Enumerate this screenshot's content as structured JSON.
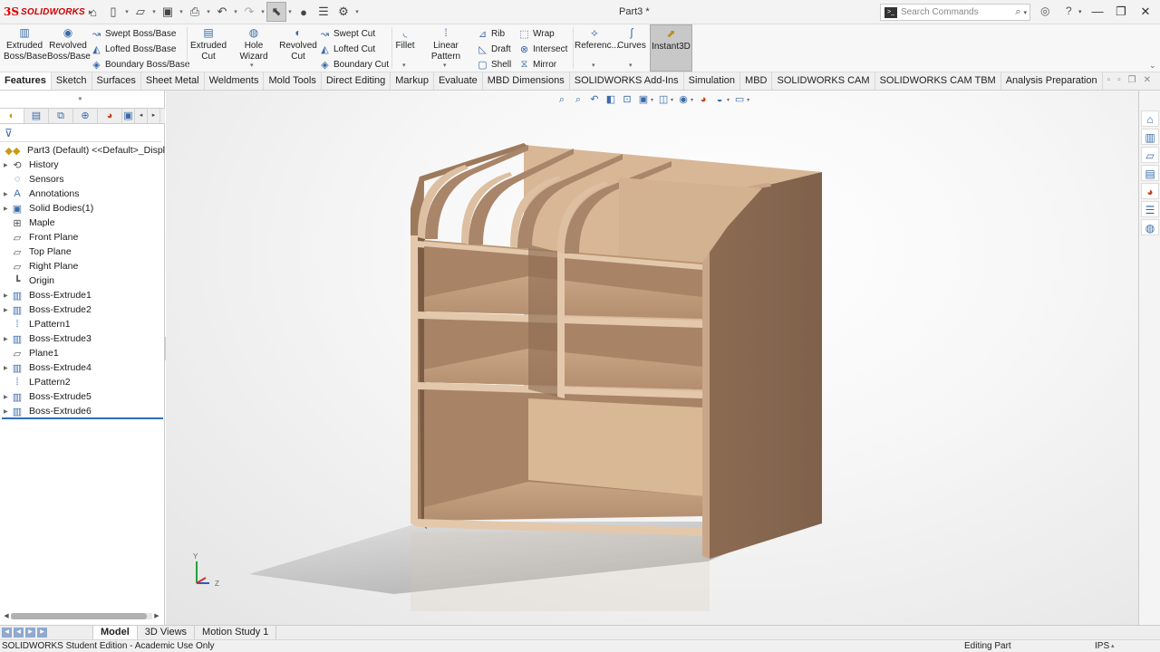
{
  "app": {
    "brand": "SOLIDWORKS",
    "doc_title": "Part3 *"
  },
  "search": {
    "placeholder": "Search Commands"
  },
  "features_toolbar": {
    "extruded_boss": "Extruded\nBoss/Base",
    "revolved_boss": "Revolved\nBoss/Base",
    "swept_boss": "Swept Boss/Base",
    "lofted_boss": "Lofted Boss/Base",
    "boundary_boss": "Boundary Boss/Base",
    "extruded_cut": "Extruded\nCut",
    "hole_wizard": "Hole Wizard",
    "revolved_cut": "Revolved\nCut",
    "swept_cut": "Swept Cut",
    "lofted_cut": "Lofted Cut",
    "boundary_cut": "Boundary Cut",
    "fillet": "Fillet",
    "linear_pattern": "Linear Pattern",
    "rib": "Rib",
    "draft": "Draft",
    "shell": "Shell",
    "wrap": "Wrap",
    "intersect": "Intersect",
    "mirror": "Mirror",
    "reference": "Referenc...",
    "curves": "Curves",
    "instant3d": "Instant3D"
  },
  "tabs": [
    "Features",
    "Sketch",
    "Surfaces",
    "Sheet Metal",
    "Weldments",
    "Mold Tools",
    "Direct Editing",
    "Markup",
    "Evaluate",
    "MBD Dimensions",
    "SOLIDWORKS Add-Ins",
    "Simulation",
    "MBD",
    "SOLIDWORKS CAM",
    "SOLIDWORKS CAM TBM",
    "Analysis Preparation"
  ],
  "tree": {
    "root": "Part3 (Default) <<Default>_Displ",
    "items": [
      {
        "label": "History",
        "expandable": true,
        "icon": "history-icon"
      },
      {
        "label": "Sensors",
        "expandable": false,
        "icon": "sensors-icon"
      },
      {
        "label": "Annotations",
        "expandable": true,
        "icon": "annotations-icon"
      },
      {
        "label": "Solid Bodies(1)",
        "expandable": true,
        "icon": "solid-bodies-icon"
      },
      {
        "label": "Maple",
        "expandable": false,
        "icon": "material-icon"
      },
      {
        "label": "Front Plane",
        "expandable": false,
        "icon": "plane-icon"
      },
      {
        "label": "Top Plane",
        "expandable": false,
        "icon": "plane-icon"
      },
      {
        "label": "Right Plane",
        "expandable": false,
        "icon": "plane-icon"
      },
      {
        "label": "Origin",
        "expandable": false,
        "icon": "origin-icon"
      },
      {
        "label": "Boss-Extrude1",
        "expandable": true,
        "icon": "extrude-icon"
      },
      {
        "label": "Boss-Extrude2",
        "expandable": true,
        "icon": "extrude-icon"
      },
      {
        "label": "LPattern1",
        "expandable": false,
        "icon": "pattern-icon"
      },
      {
        "label": "Boss-Extrude3",
        "expandable": true,
        "icon": "extrude-icon"
      },
      {
        "label": "Plane1",
        "expandable": false,
        "icon": "plane-icon"
      },
      {
        "label": "Boss-Extrude4",
        "expandable": true,
        "icon": "extrude-icon"
      },
      {
        "label": "LPattern2",
        "expandable": false,
        "icon": "pattern-icon"
      },
      {
        "label": "Boss-Extrude5",
        "expandable": true,
        "icon": "extrude-icon"
      },
      {
        "label": "Boss-Extrude6",
        "expandable": true,
        "icon": "extrude-icon"
      }
    ]
  },
  "triad": {
    "y": "Y",
    "z": "Z"
  },
  "bottom_tabs": [
    "Model",
    "3D Views",
    "Motion Study 1"
  ],
  "status": {
    "left": "SOLIDWORKS Student Edition - Academic Use Only",
    "editing": "Editing Part",
    "units": "IPS"
  },
  "colors": {
    "wood": "#c39a77",
    "wood_dark": "#8a6a52",
    "accent": "#2f6fb7",
    "brand_red": "#cc0000"
  }
}
